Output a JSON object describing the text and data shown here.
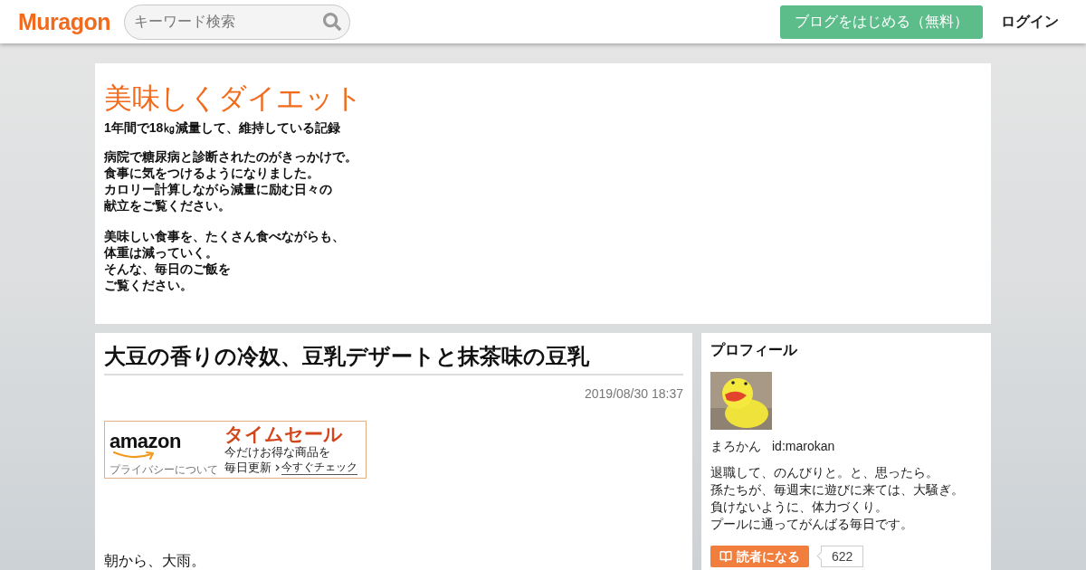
{
  "header": {
    "logo": "Muragon",
    "search": {
      "placeholder": "キーワード検索"
    },
    "start_button": "ブログをはじめる（無料）",
    "login_link": "ログイン"
  },
  "blog": {
    "title": "美味しくダイエット",
    "subtitle": "1年間で18㎏減量して、維持している記録",
    "description": [
      [
        "病院で糖尿病と診断されたのがきっかけで。",
        "食事に気をつけるようになりました。",
        "カロリー計算しながら減量に励む日々の",
        "献立をご覧ください。"
      ],
      [
        "美味しい食事を、たくさん食べながらも、",
        "体重は減っていく。",
        "そんな、毎日のご飯を",
        "ご覧ください。"
      ]
    ]
  },
  "article": {
    "title": "大豆の香りの冷奴、豆乳デザートと抹茶味の豆乳",
    "date": "2019/08/30 18:37",
    "ad": {
      "logo": "amazon",
      "privacy_link": "プライバシーについて",
      "headline": "タイムセール",
      "line": "今だけお得な商品を",
      "note": "毎日更新",
      "link": "今すぐチェック"
    },
    "body": [
      "朝から、大雨。"
    ]
  },
  "profile": {
    "heading": "プロフィール",
    "name": "まろかん",
    "user_id": "id:marokan",
    "bio": [
      "退職して、のんびりと。と、思ったら。",
      "孫たちが、毎週末に遊びに来ては、大騒ぎ。",
      "負けないように、体力づくり。",
      "プールに通ってがんばる毎日です。"
    ],
    "follow_button": "読者になる",
    "follower_count": "622"
  }
}
